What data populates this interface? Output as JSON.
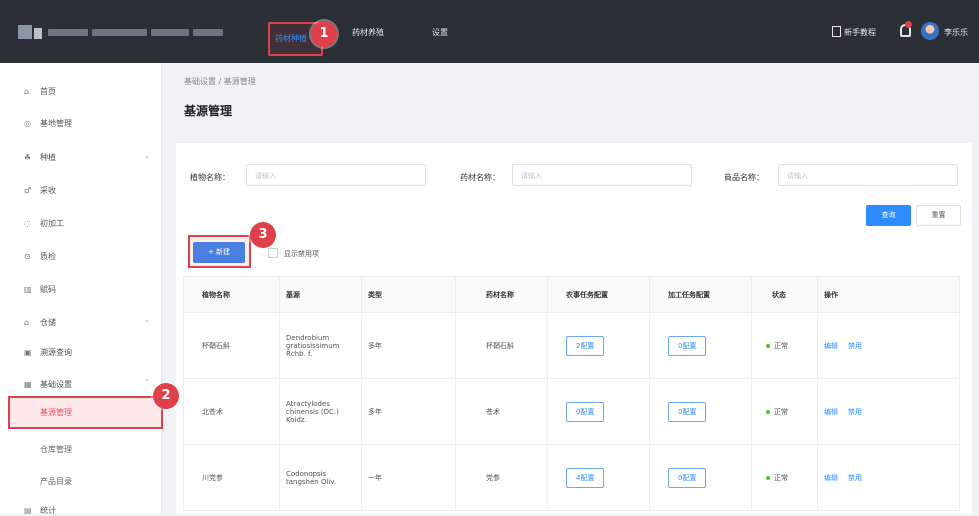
{
  "topbar": {
    "nav": [
      "药材种植",
      "药材养殖",
      "设置"
    ],
    "tutorial": "新手教程",
    "user": "李乐乐",
    "colors": {
      "bg": "#2b2f36",
      "accent": "#2f8cff",
      "callout": "#e0404a"
    }
  },
  "callouts": [
    "1",
    "2",
    "3"
  ],
  "sidebar": {
    "items": [
      {
        "label": "首页",
        "icon": "home-icon"
      },
      {
        "label": "基地管理",
        "icon": "location-icon"
      },
      {
        "label": "种植",
        "icon": "plant-icon"
      },
      {
        "label": "采收",
        "icon": "harvest-icon"
      },
      {
        "label": "初加工",
        "icon": "process-icon"
      },
      {
        "label": "质检",
        "icon": "check-icon"
      },
      {
        "label": "赋码",
        "icon": "barcode-icon"
      },
      {
        "label": "仓储",
        "icon": "warehouse-icon"
      },
      {
        "label": "溯源查询",
        "icon": "search-icon"
      },
      {
        "label": "基础设置",
        "icon": "settings-icon"
      }
    ],
    "sub": [
      "基源管理",
      "仓库管理",
      "产品目录"
    ],
    "bottom": "统计"
  },
  "breadcrumb": "基础设置 / 基源管理",
  "page_title": "基源管理",
  "filters": {
    "plant_label": "植物名称：",
    "herb_label": "药材名称：",
    "product_label": "商品名称：",
    "placeholder": "请输入"
  },
  "buttons": {
    "search": "查询",
    "reset": "重置",
    "add": "+ 新建",
    "show_disabled": "显示禁用项"
  },
  "table": {
    "columns": [
      "植物名称",
      "基源",
      "类型",
      "药材名称",
      "农事任务配置",
      "加工任务配置",
      "状态",
      "操作"
    ],
    "rows": [
      {
        "plant": "杯鞘石斛",
        "source": "Dendrobium gratiosissimum Rchb. f.",
        "type": "多年",
        "herb": "杯鞘石斛",
        "farm": "2配置",
        "proc": "0配置",
        "status": "正常",
        "edit": "编辑",
        "disable": "禁用"
      },
      {
        "plant": "北苍术",
        "source": "Atractylodes chinensis (DC.) Koidz.",
        "type": "多年",
        "herb": "苍术",
        "farm": "0配置",
        "proc": "0配置",
        "status": "正常",
        "edit": "编辑",
        "disable": "禁用"
      },
      {
        "plant": "川党参",
        "source": "Codonopsis tangshen Oliv.",
        "type": "一年",
        "herb": "党参",
        "farm": "4配置",
        "proc": "0配置",
        "status": "正常",
        "edit": "编辑",
        "disable": "禁用"
      }
    ]
  }
}
